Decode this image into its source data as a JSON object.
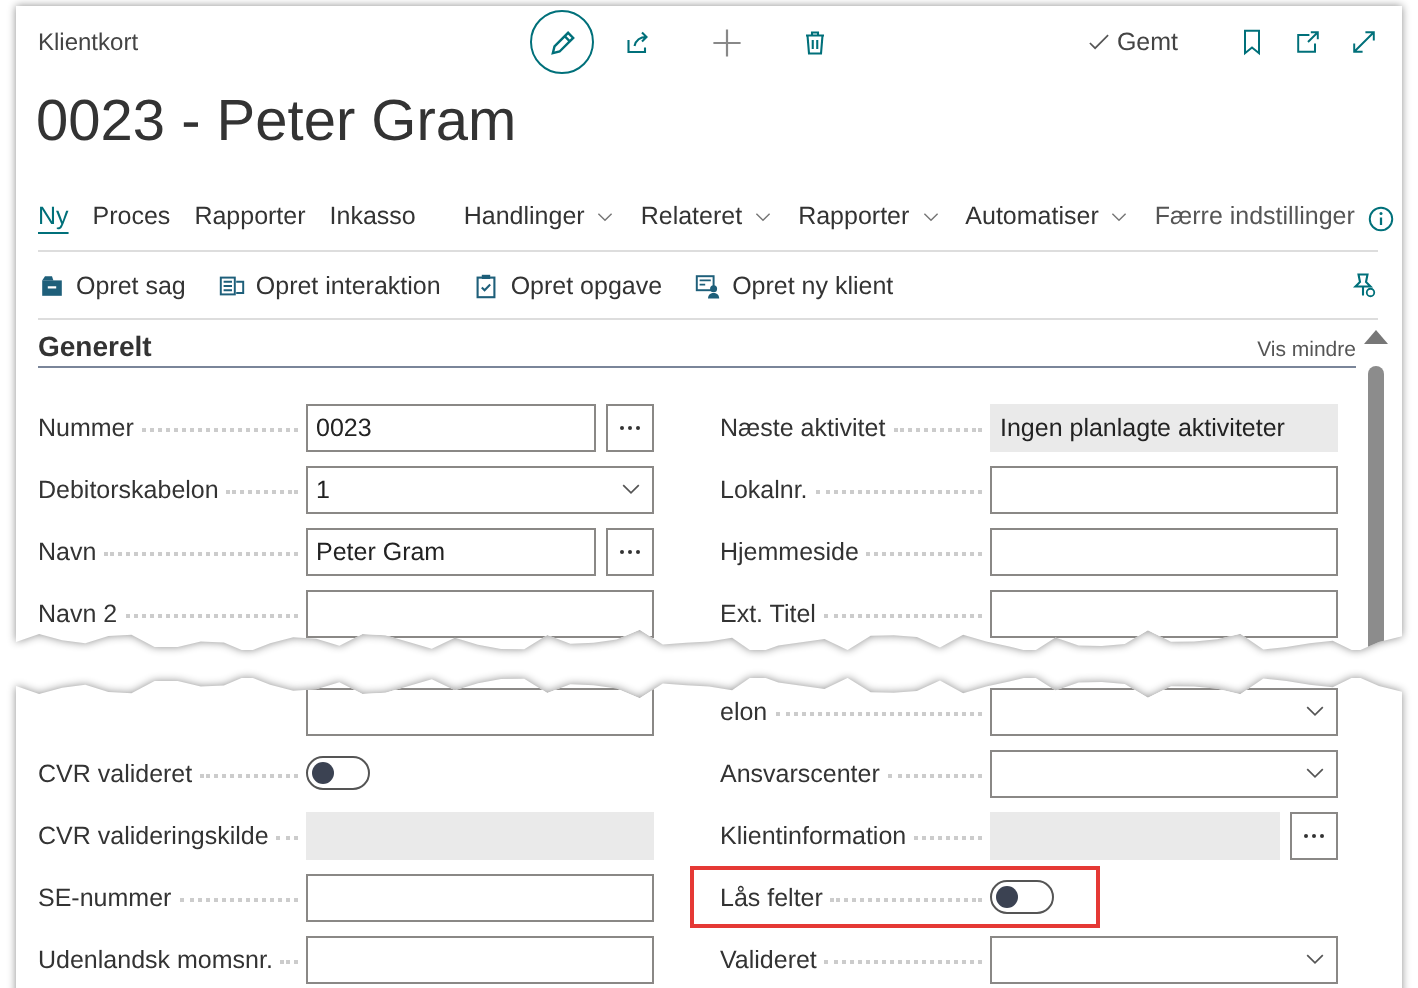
{
  "page": {
    "caption": "Klientkort",
    "title": "0023 - Peter Gram",
    "saved_status": "Gemt"
  },
  "action_tabs": [
    {
      "label": "Ny",
      "kind": "tab",
      "selected": true
    },
    {
      "label": "Proces",
      "kind": "tab",
      "selected": false
    },
    {
      "label": "Rapporter",
      "kind": "tab",
      "selected": false
    },
    {
      "label": "Inkasso",
      "kind": "tab",
      "selected": false
    },
    {
      "label": "Handlinger",
      "kind": "menu",
      "selected": false
    },
    {
      "label": "Relateret",
      "kind": "menu",
      "selected": false
    },
    {
      "label": "Rapporter",
      "kind": "menu",
      "selected": false
    },
    {
      "label": "Automatiser",
      "kind": "menu",
      "selected": false
    },
    {
      "label": "Færre indstillinger",
      "kind": "link",
      "selected": false
    }
  ],
  "actions": [
    {
      "label": "Opret sag"
    },
    {
      "label": "Opret interaktion"
    },
    {
      "label": "Opret opgave"
    },
    {
      "label": "Opret ny klient"
    }
  ],
  "section": {
    "title": "Generelt",
    "toggle": "Vis mindre"
  },
  "upper_rows": [
    {
      "left": {
        "label": "Nummer",
        "kind": "lookup",
        "value": "0023"
      },
      "right": {
        "label": "Næste aktivitet",
        "kind": "readonly",
        "value": "Ingen planlagte aktiviteter"
      }
    },
    {
      "left": {
        "label": "Debitorskabelon",
        "kind": "dropdown",
        "value": "1"
      },
      "right": {
        "label": "Lokalnr.",
        "kind": "text"
      }
    },
    {
      "left": {
        "label": "Navn",
        "kind": "lookup",
        "value": "Peter Gram"
      },
      "right": {
        "label": "Hjemmeside",
        "kind": "text"
      }
    },
    {
      "left": {
        "label": "Navn 2",
        "kind": "text"
      },
      "right": {
        "label": "Ext. Titel",
        "kind": "text"
      }
    }
  ],
  "lower_rows": [
    {
      "left": {
        "kind": "text"
      },
      "right": {
        "label": "elon",
        "kind": "dropdown"
      }
    },
    {
      "left": {
        "label": "CVR valideret",
        "kind": "toggle",
        "on": false
      },
      "right": {
        "label": "Ansvarscenter",
        "kind": "dropdown"
      }
    },
    {
      "left": {
        "label": "CVR valideringskilde",
        "kind": "readonly"
      },
      "right": {
        "label": "Klientinformation",
        "kind": "readonly_lookup"
      }
    },
    {
      "left": {
        "label": "SE-nummer",
        "kind": "text"
      },
      "right": {
        "label": "Lås felter",
        "kind": "toggle",
        "on": false,
        "highlighted": true
      }
    },
    {
      "left": {
        "label": "Udenlandsk momsnr.",
        "kind": "text"
      },
      "right": {
        "label": "Valideret",
        "kind": "dropdown"
      }
    }
  ]
}
